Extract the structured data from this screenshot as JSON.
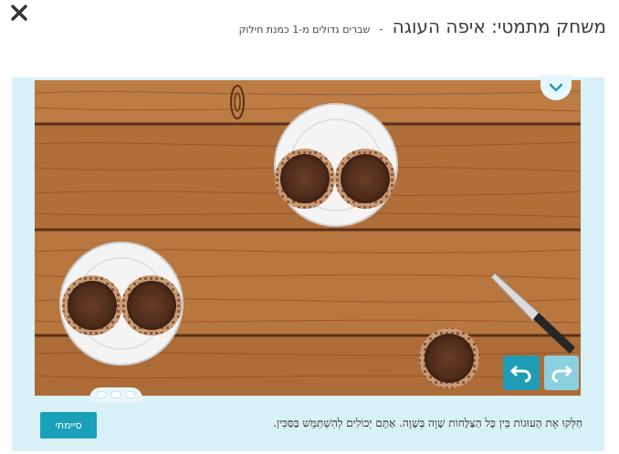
{
  "header": {
    "title": "משחק מתמטי: איפה העוגה",
    "separator": "-",
    "subtitle": "שברים גדולים מ-1 כמנת חילוק"
  },
  "icons": {
    "close": "close-icon",
    "collapse": "chevron-down-icon",
    "undo": "undo-icon",
    "redo": "redo-icon",
    "knife": "knife-icon"
  },
  "game": {
    "plates": [
      {
        "id": "plate-top",
        "pies": 2
      },
      {
        "id": "plate-left",
        "pies": 2
      }
    ],
    "loose_pies": 1,
    "instruction": "חַלְּקוּ אֶת הָעוּגוֹת בֵּין כָּל הַצַּלָּחוֹת שָׁוֶה בְּשָׁוֶה. אַתֶּם יְכוֹלִים לְהִשְׁתַּמֵּשׁ בַּסַּכִּין.",
    "done_label": "סיימתי"
  },
  "colors": {
    "frame": "#d8f1f7",
    "accent": "#1aa0b9",
    "accent_disabled": "#8bd0de",
    "wood": "#b5743d",
    "pie_filling": "#5a3322"
  }
}
